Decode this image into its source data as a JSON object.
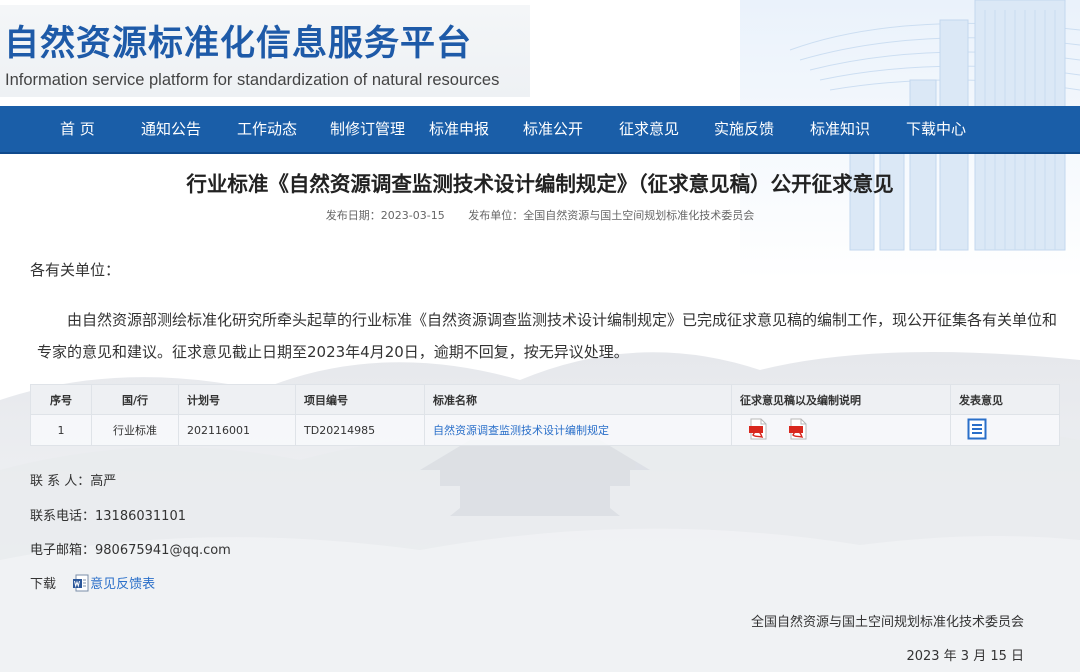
{
  "header": {
    "title_cn": "自然资源标准化信息服务平台",
    "title_en": "Information service platform for standardization of natural resources"
  },
  "nav": {
    "items": [
      "首 页",
      "通知公告",
      "工作动态",
      "制修订管理",
      "标准申报",
      "标准公开",
      "征求意见",
      "实施反馈",
      "标准知识",
      "下载中心"
    ]
  },
  "article": {
    "title": "行业标准《自然资源调查监测技术设计编制规定》（征求意见稿）公开征求意见",
    "publish_date": "发布日期：2023-03-15",
    "publisher": "发布单位：全国自然资源与国土空间规划标准化技术委员会",
    "salutation": "各有关单位：",
    "body": "由自然资源部测绘标准化研究所牵头起草的行业标准《自然资源调查监测技术设计编制规定》已完成征求意见稿的编制工作，现公开征集各有关单位和专家的意见和建议。征求意见截止日期至2023年4月20日，逾期不回复，按无异议处理。"
  },
  "table": {
    "headers": {
      "seq": "序号",
      "type": "国/行",
      "plan_no": "计划号",
      "project_no": "项目编号",
      "std_name": "标准名称",
      "draft": "征求意见稿以及编制说明",
      "comment": "发表意见"
    },
    "rows": [
      {
        "seq": "1",
        "type": "行业标准",
        "plan_no": "202116001",
        "project_no": "TD20214985",
        "std_name": "自然资源调查监测技术设计编制规定"
      }
    ]
  },
  "contact": {
    "person": "联 系 人：高严",
    "phone": "联系电话：13186031101",
    "email": "电子邮箱：980675941@qq.com",
    "download_label": "下载",
    "download_link": "意见反馈表"
  },
  "signature": {
    "org": "全国自然资源与国土空间规划标准化技术委员会",
    "date": "2023 年 3 月 15 日"
  },
  "colors": {
    "nav_bg": "#1a5ea8",
    "logo_text": "#1e5aa8",
    "link": "#2a6fc9",
    "pdf_red": "#d9281e"
  }
}
